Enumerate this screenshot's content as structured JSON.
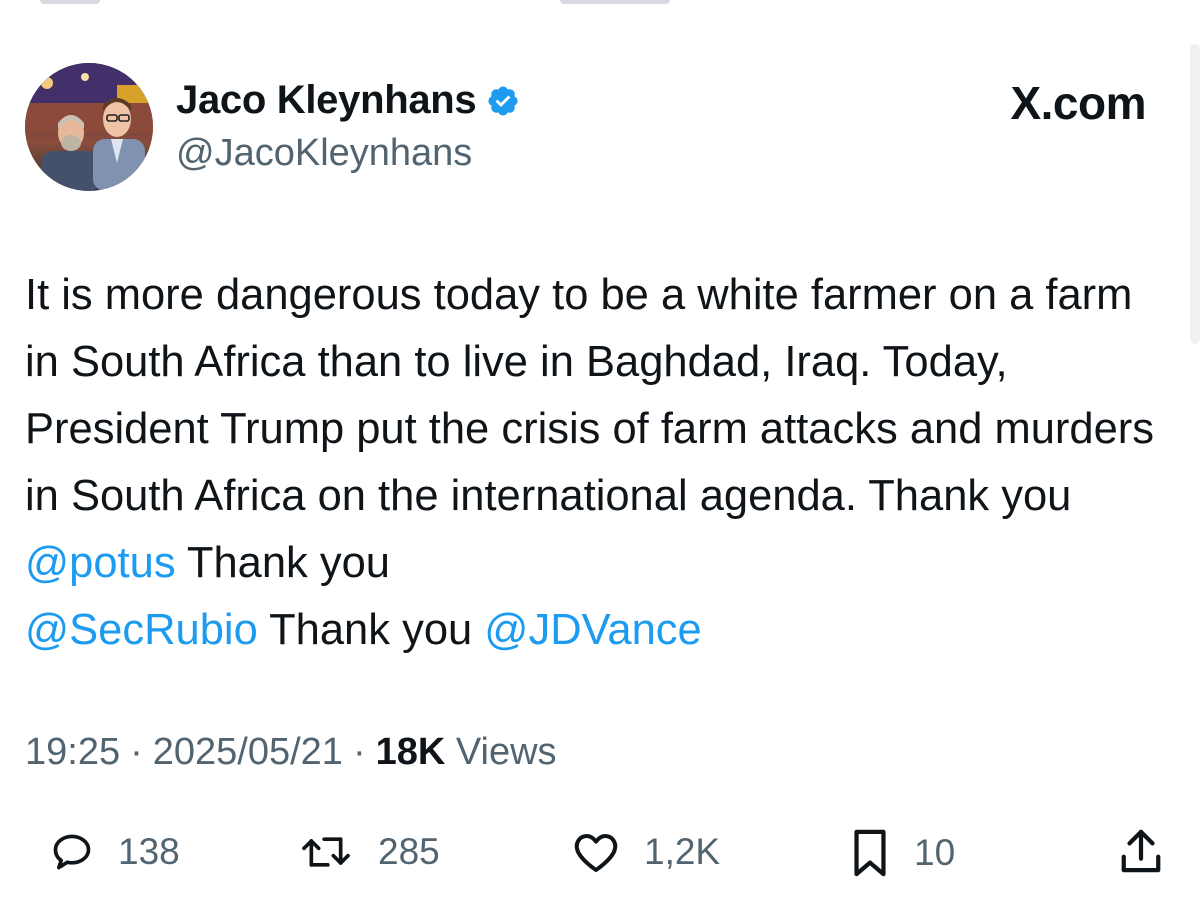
{
  "tweet": {
    "display_name": "Jaco Kleynhans",
    "handle": "@JacoKleynhans",
    "brand": "X.com",
    "text_parts": {
      "t1": "It is more dangerous today to be a white farmer on a farm in South Africa than to live in Baghdad, Iraq. Today, President Trump put the crisis of farm attacks and murders in South Africa on the international agenda. Thank you ",
      "m1": "@potus",
      "t2": " Thank you ",
      "m2": "@SecRubio",
      "t3": " Thank you ",
      "m3": "@JDVance"
    },
    "time": "19:25",
    "date": "2025/05/21",
    "separator": "·",
    "views_count": "18K",
    "views_label": "Views"
  },
  "actions": {
    "replies": "138",
    "reposts": "285",
    "likes": "1,2K",
    "bookmarks": "10"
  },
  "colors": {
    "accent": "#1d9bf0",
    "secondary_text": "#536471",
    "primary_text": "#0f1419"
  },
  "icons": [
    "verified-badge-icon",
    "reply-icon",
    "repost-icon",
    "like-icon",
    "bookmark-icon",
    "share-icon"
  ]
}
